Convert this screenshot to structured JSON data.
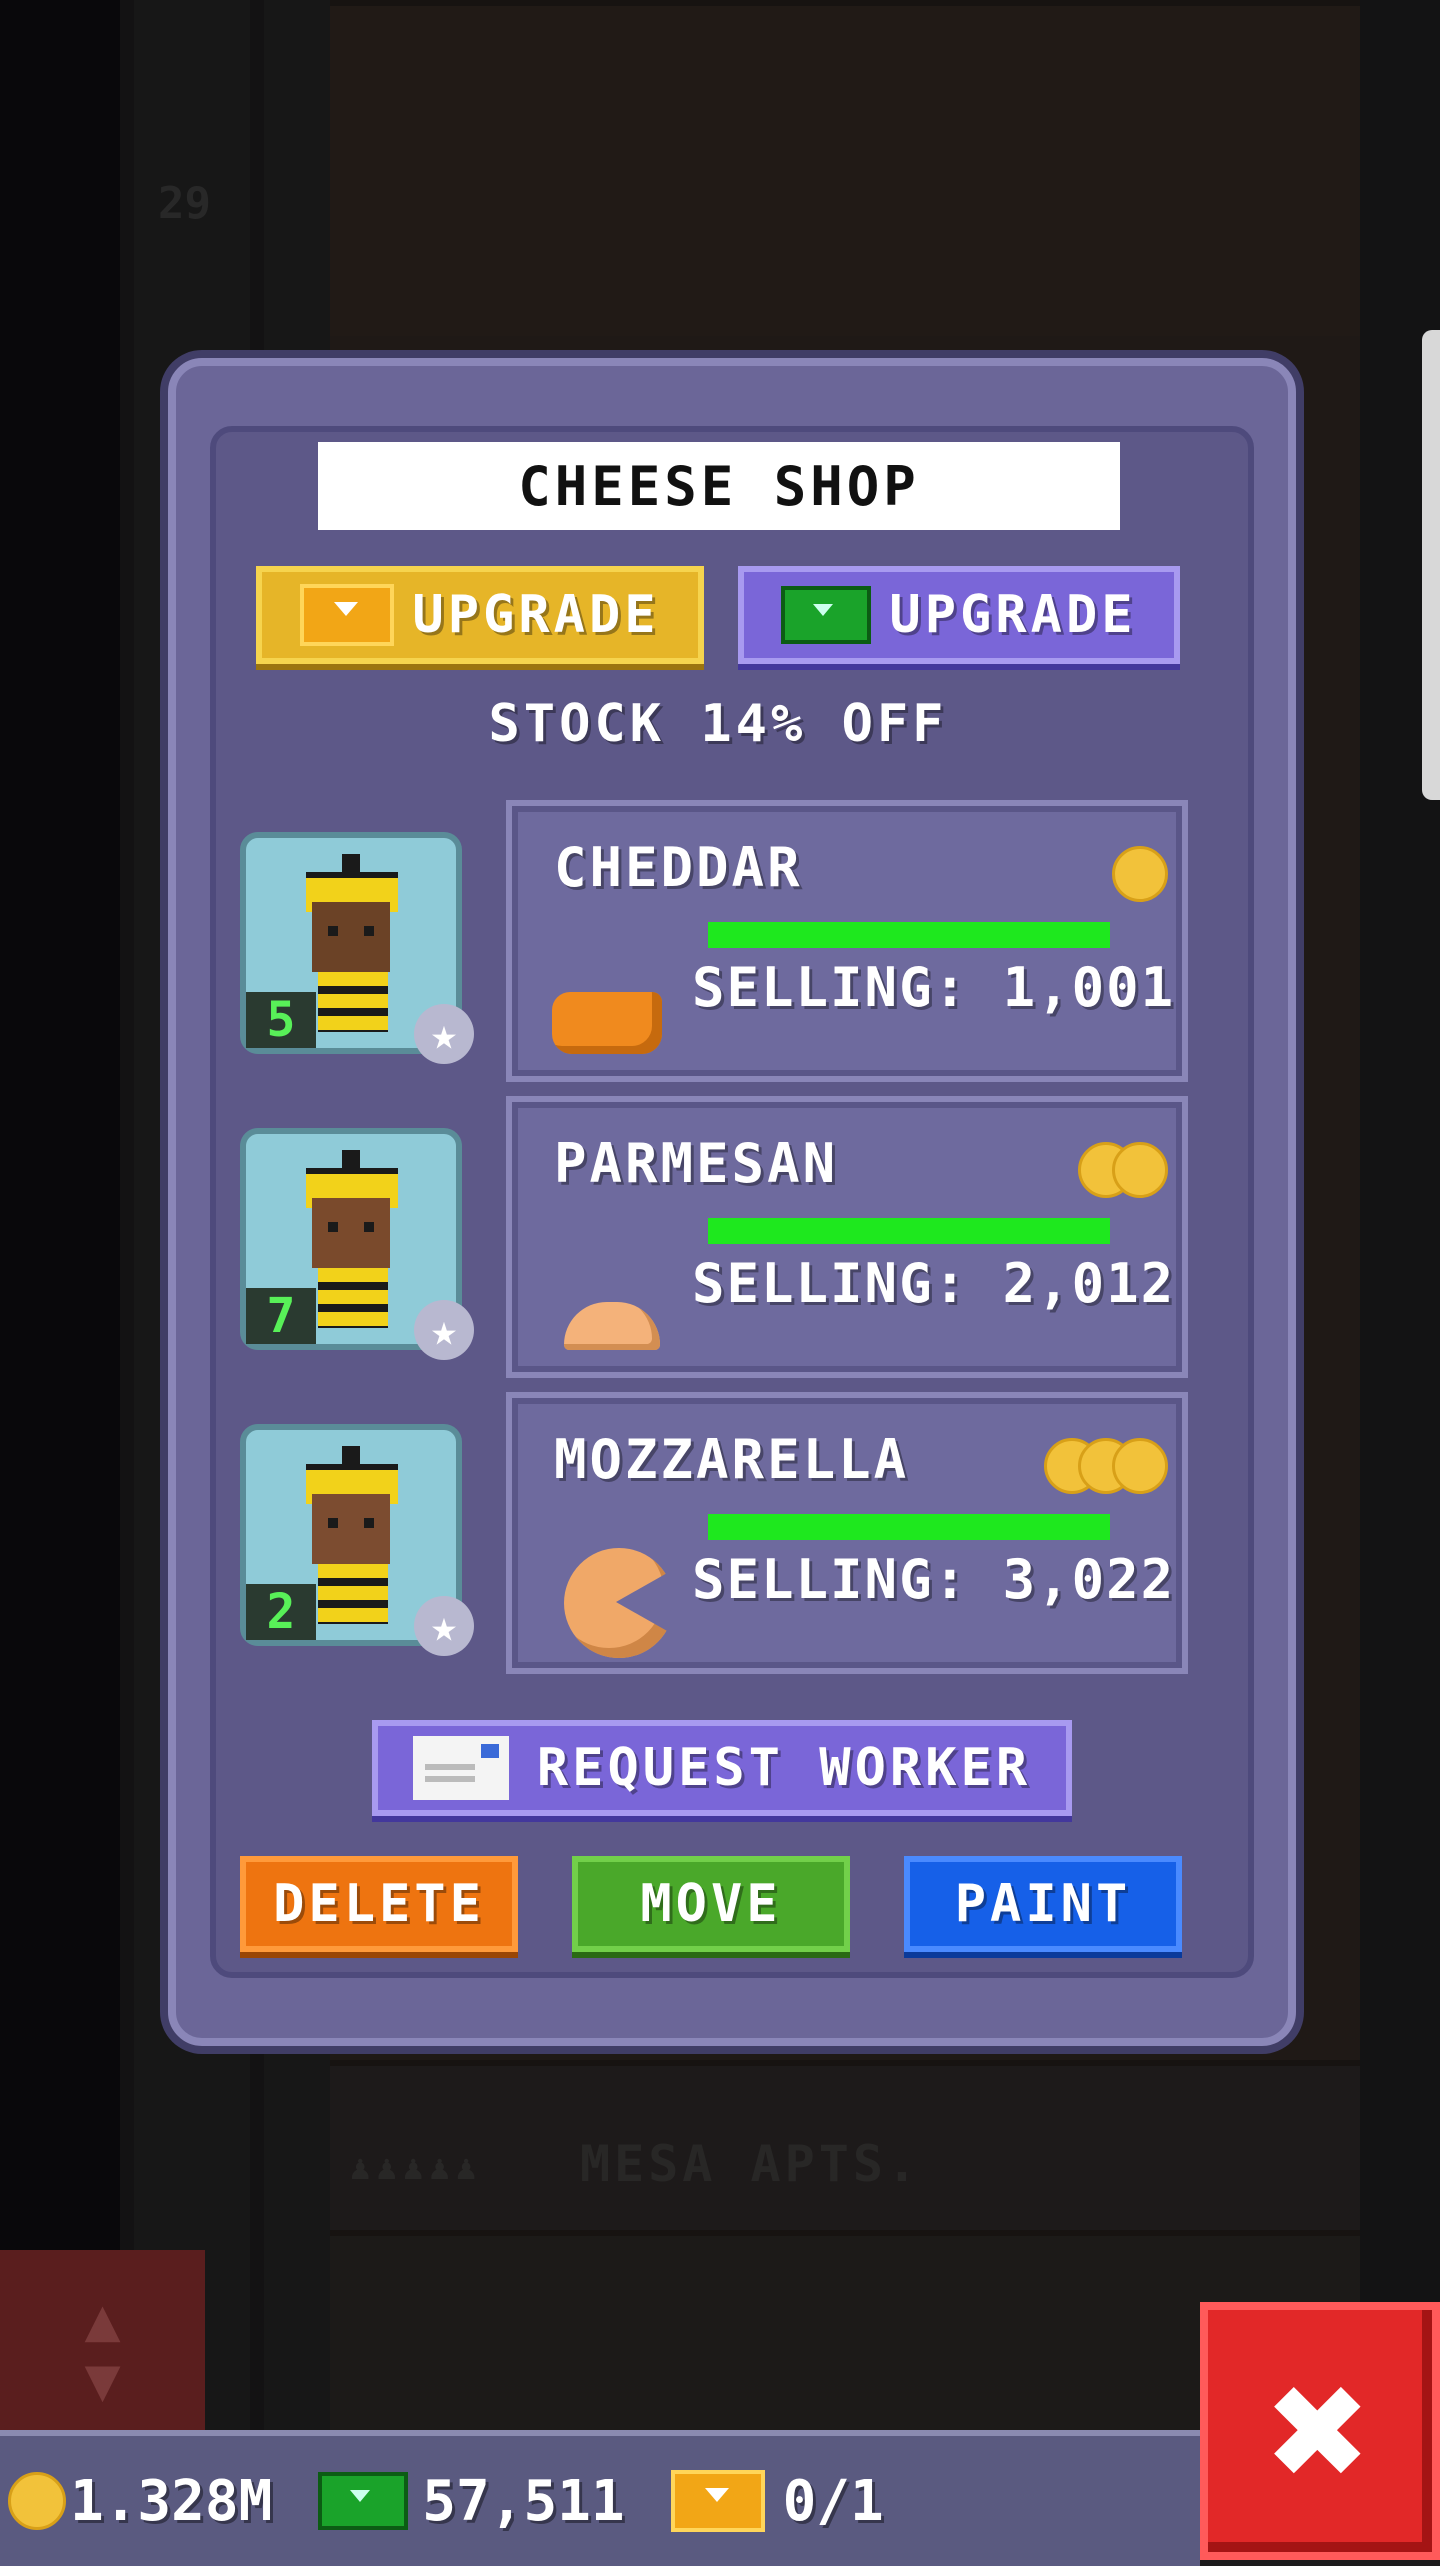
{
  "background": {
    "floor_number": "29",
    "mesa_label": "MESA APTS.",
    "residents": "♟♟♟♟♟"
  },
  "modal": {
    "title": "CHEESE SHOP",
    "upgrade_gold_label": "UPGRADE",
    "upgrade_bux_label": "UPGRADE",
    "stock_text": "STOCK 14% OFF",
    "workers": [
      {
        "level": "5"
      },
      {
        "level": "7"
      },
      {
        "level": "2"
      }
    ],
    "products": [
      {
        "name": "CHEDDAR",
        "selling": "SELLING: 1,001",
        "coins": 1,
        "stock_fraction": 1.0
      },
      {
        "name": "PARMESAN",
        "selling": "SELLING: 2,012",
        "coins": 2,
        "stock_fraction": 1.0
      },
      {
        "name": "MOZZARELLA",
        "selling": "SELLING: 3,022",
        "coins": 3,
        "stock_fraction": 1.0
      }
    ],
    "request_worker_label": "REQUEST WORKER",
    "delete_label": "DELETE",
    "move_label": "MOVE",
    "paint_label": "PAINT"
  },
  "status": {
    "coins": "1.328M",
    "bux": "57,511",
    "tickets": "0/1"
  },
  "icons": {
    "close": "close-icon",
    "coin": "coin-icon",
    "bux": "bux-icon",
    "ticket": "golden-ticket-icon",
    "mail": "mail-icon",
    "star": "star-icon"
  },
  "colors": {
    "modal_bg": "#6b6698",
    "stock_bar": "#1ee81e",
    "upgrade_gold": "#e6b528",
    "upgrade_bux": "#7a66d8",
    "delete": "#ee7410",
    "move": "#4aa82a",
    "paint": "#1660e8",
    "close": "#e22828"
  }
}
